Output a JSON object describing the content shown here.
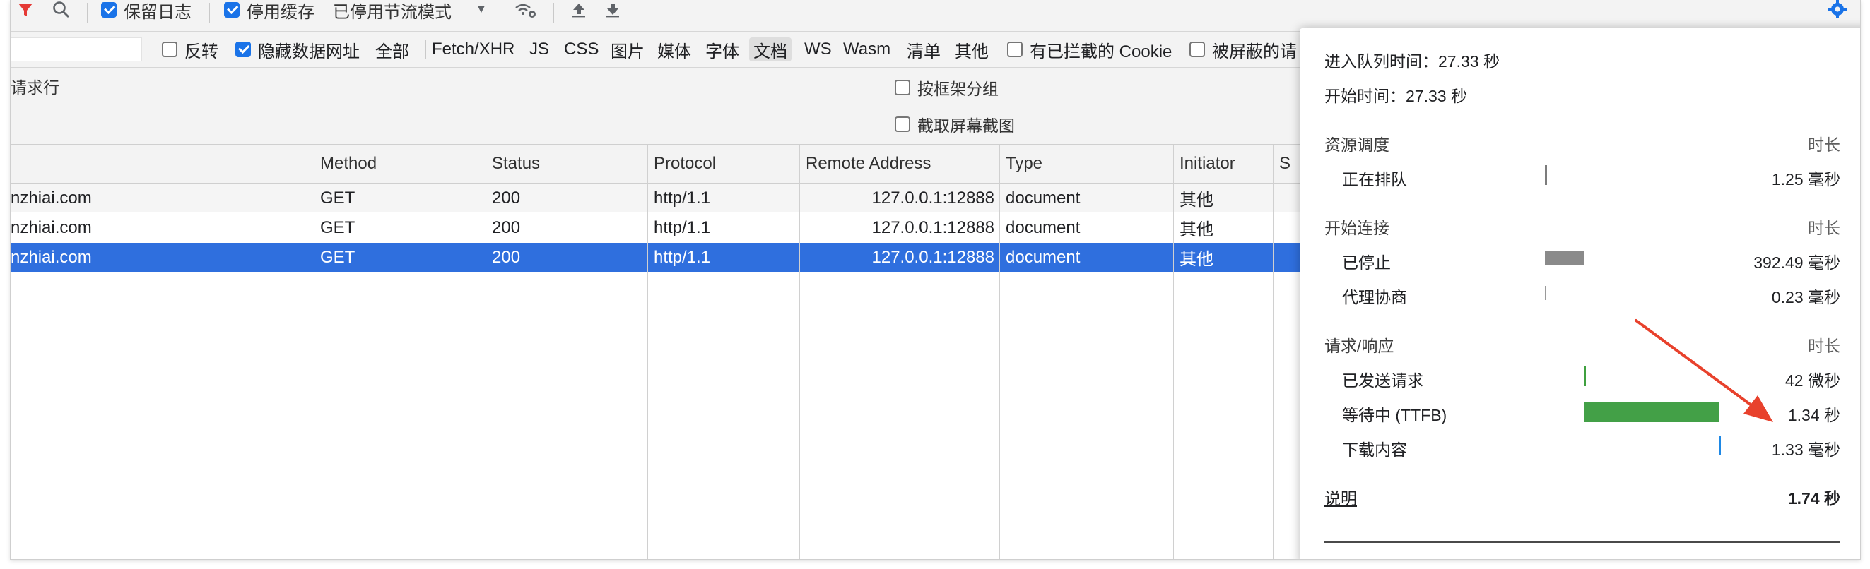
{
  "toolbar": {
    "preserve_log_label": "保留日志",
    "disable_cache_label": "停用缓存",
    "throttle_label": "已停用节流模式"
  },
  "filter": {
    "input_value": "",
    "invert_label": "反转",
    "hide_data_urls_label": "隐藏数据网址",
    "types": [
      "全部",
      "Fetch/XHR",
      "JS",
      "CSS",
      "图片",
      "媒体",
      "字体",
      "文档",
      "WS",
      "Wasm",
      "清单",
      "其他"
    ],
    "selected_type": "文档",
    "blocked_cookies_label": "有已拦截的 Cookie",
    "blocked_requests_label": "被屏蔽的请"
  },
  "options": {
    "left_label": "请求行",
    "group_by_frame_label": "按框架分组",
    "screenshots_label": "截取屏幕截图"
  },
  "table": {
    "columns": [
      "Method",
      "Status",
      "Protocol",
      "Remote Address",
      "Type",
      "Initiator",
      "S"
    ],
    "rows": [
      {
        "name": "nzhiai.com",
        "method": "GET",
        "status": "200",
        "protocol": "http/1.1",
        "remote": "127.0.0.1:12888",
        "type": "document",
        "initiator": "其他"
      },
      {
        "name": "nzhiai.com",
        "method": "GET",
        "status": "200",
        "protocol": "http/1.1",
        "remote": "127.0.0.1:12888",
        "type": "document",
        "initiator": "其他"
      },
      {
        "name": "nzhiai.com",
        "method": "GET",
        "status": "200",
        "protocol": "http/1.1",
        "remote": "127.0.0.1:12888",
        "type": "document",
        "initiator": "其他"
      }
    ],
    "selected_row": 2
  },
  "timing": {
    "queued_at": "进入队列时间：27.33 秒",
    "started_at": "开始时间：27.33 秒",
    "duration_label": "时长",
    "sections": [
      {
        "title": "资源调度",
        "items": [
          {
            "label": "正在排队",
            "value": "1.25 毫秒"
          }
        ]
      },
      {
        "title": "开始连接",
        "items": [
          {
            "label": "已停止",
            "value": "392.49 毫秒"
          },
          {
            "label": "代理协商",
            "value": "0.23 毫秒"
          }
        ]
      },
      {
        "title": "请求/响应",
        "items": [
          {
            "label": "已发送请求",
            "value": "42 微秒"
          },
          {
            "label": "等待中 (TTFB)",
            "value": "1.34 秒"
          },
          {
            "label": "下载内容",
            "value": "1.33 毫秒"
          }
        ]
      }
    ],
    "explain_label": "说明",
    "total": "1.74 秒"
  },
  "colors": {
    "accent": "#1a73e8",
    "selected_row": "#2f6fde",
    "ttfb_bar": "#43a047",
    "stalled_bar": "#8a8a8a",
    "annotation_arrow": "#e8412c"
  }
}
